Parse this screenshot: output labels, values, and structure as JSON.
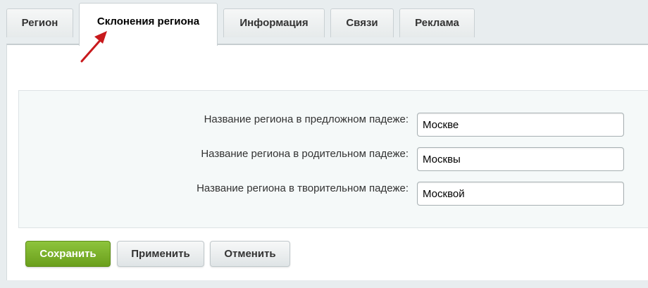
{
  "tabs": [
    {
      "label": "Регион",
      "active": false
    },
    {
      "label": "Склонения региона",
      "active": true
    },
    {
      "label": "Информация",
      "active": false
    },
    {
      "label": "Связи",
      "active": false
    },
    {
      "label": "Реклама",
      "active": false
    }
  ],
  "form": {
    "fields": [
      {
        "label": "Название региона в предложном падеже:",
        "value": "Москве"
      },
      {
        "label": "Название региона в родительном падеже:",
        "value": "Москвы"
      },
      {
        "label": "Название региона в творительном падеже:",
        "value": "Москвой"
      }
    ]
  },
  "buttons": {
    "save": "Сохранить",
    "apply": "Применить",
    "cancel": "Отменить"
  },
  "colors": {
    "save_button": "#7db32b",
    "annotation_arrow": "#c8191c",
    "background": "#e8edef"
  },
  "annotation": {
    "icon": "red-arrow-icon",
    "points_to": "tab-declensions"
  }
}
